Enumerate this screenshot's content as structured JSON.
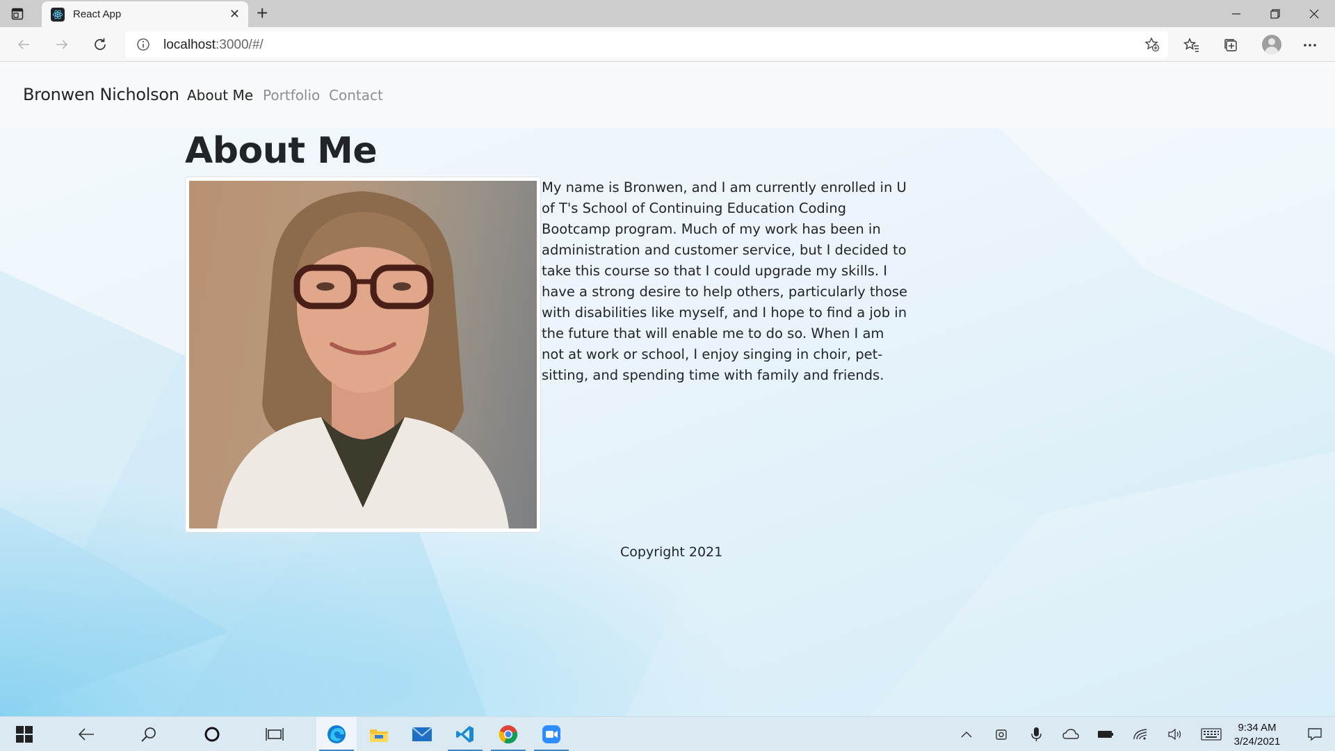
{
  "browser": {
    "tab_title": "React App",
    "url_host": "localhost",
    "url_rest": ":3000/#/"
  },
  "site": {
    "brand": "Bronwen Nicholson",
    "nav": [
      {
        "label": "About Me",
        "active": true
      },
      {
        "label": "Portfolio",
        "active": false
      },
      {
        "label": "Contact",
        "active": false
      }
    ],
    "heading": "About Me",
    "bio": "My name is Bronwen, and I am currently enrolled in U of T's School of Continuing Education Coding Bootcamp program. Much of my work has been in administration and customer service, but I decided to take this course so that I could upgrade my skills. I have a strong desire to help others, particularly those with disabilities like myself, and I hope to find a job in the future that will enable me to do so. When I am not at work or school, I enjoy singing in choir, pet-sitting, and spending time with family and friends.",
    "footer": "Copyright 2021"
  },
  "taskbar": {
    "time": "9:34 AM",
    "date": "3/24/2021",
    "apps": [
      "edge-icon",
      "file-explorer-icon",
      "mail-icon",
      "vscode-icon",
      "chrome-icon",
      "zoom-icon"
    ]
  }
}
